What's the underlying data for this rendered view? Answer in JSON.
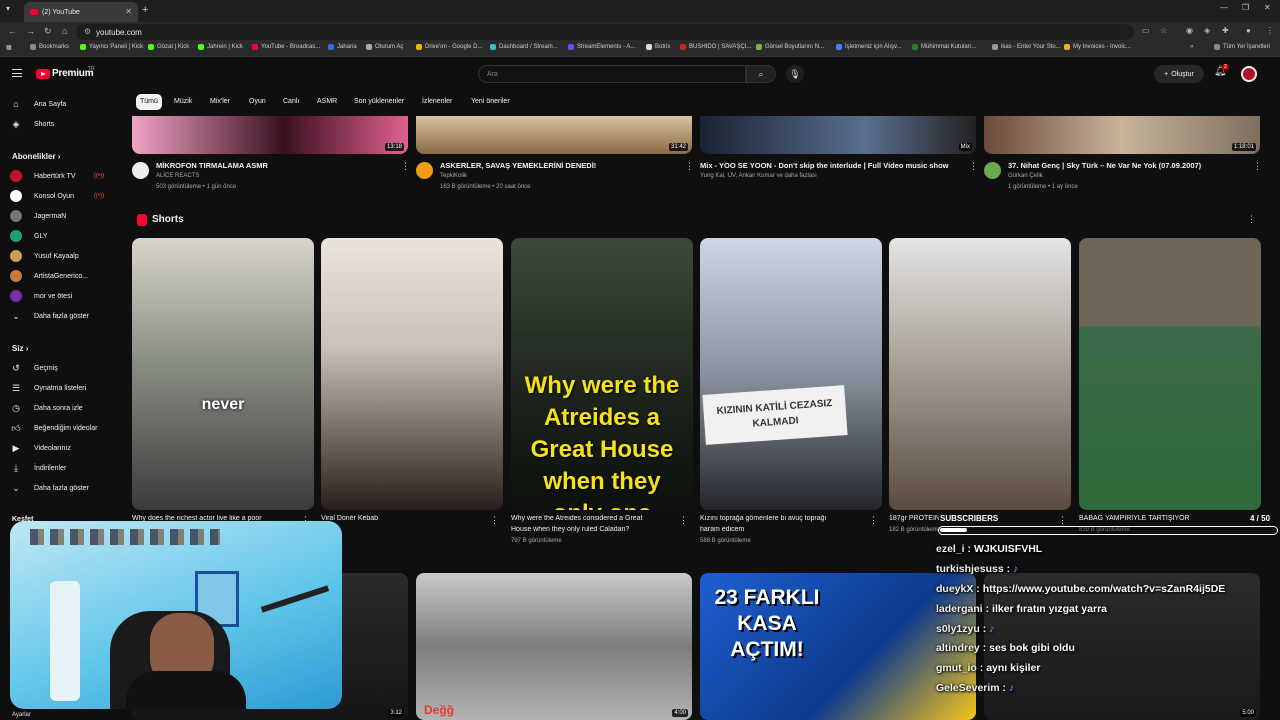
{
  "browser": {
    "tab_title": "(2) YouTube",
    "url": "youtube.com",
    "bookmarks": [
      "Bookmarks",
      "Yayıncı Paneli | Kick",
      "Gözat | Kick",
      "Jahrein | Kick",
      "YouTube - Broadcas...",
      "Jaharia",
      "Oturum Aç",
      "Drive'ım - Google D...",
      "Dashboard / Stream...",
      "StreamElements - A...",
      "Botrix",
      "BUSHIDO | SAVAŞÇI...",
      "Görsel Boyutlarını N...",
      "İşletmeniz için Alışv...",
      "Mühimmat Kutuları...",
      "ikas - Enter Your Sto...",
      "My Invoices - Invoic..."
    ],
    "all_bookmarks": "Tüm Yer İşaretleri"
  },
  "header": {
    "logo_text": "Premium",
    "logo_sup": "TR",
    "search_placeholder": "Ara",
    "create_label": "Oluştur",
    "notif_count": "2"
  },
  "sidebar": {
    "main": [
      {
        "label": "Ana Sayfa",
        "icon": "home-icon"
      },
      {
        "label": "Shorts",
        "icon": "shorts-icon"
      }
    ],
    "subs_title": "Abonelikler",
    "subs": [
      {
        "label": "Habertürk TV",
        "color": "#c4122e",
        "live": true
      },
      {
        "label": "Konsol Oyun",
        "color": "#ffffff",
        "live": true
      },
      {
        "label": "JagermaN",
        "color": "#777777",
        "live": false
      },
      {
        "label": "GLY",
        "color": "#1aa36b",
        "live": false
      },
      {
        "label": "Yusuf Kayaalp",
        "color": "#c8a05a",
        "live": false
      },
      {
        "label": "ArtistaGenerico...",
        "color": "#c97a3a",
        "live": false
      },
      {
        "label": "mor ve ötesi",
        "color": "#7a2fa5",
        "live": false
      }
    ],
    "subs_more": "Daha fazla göster",
    "you_title": "Siz",
    "you": [
      {
        "label": "Geçmiş",
        "icon": "history-icon"
      },
      {
        "label": "Oynatma listeleri",
        "icon": "playlist-icon"
      },
      {
        "label": "Daha sonra izle",
        "icon": "watch-later-icon"
      },
      {
        "label": "Beğendiğim videolar",
        "icon": "like-icon"
      },
      {
        "label": "Videolarınız",
        "icon": "your-videos-icon"
      },
      {
        "label": "İndirilenler",
        "icon": "download-icon"
      },
      {
        "label": "Daha fazla göster",
        "icon": "chevron-down-icon"
      }
    ],
    "explore": "Keşfet",
    "settings": "Ayarlar"
  },
  "chips": [
    "Tümü",
    "Müzik",
    "Mix'ler",
    "Oyun",
    "Canlı",
    "ASMR",
    "Son yüklenenler",
    "İzlenenler",
    "Yeni öneriler"
  ],
  "videos": [
    {
      "title": "MİKROFON TIRMALAMA ASMR",
      "channel": "ALİCE REACTS",
      "meta": "503 görüntüleme • 1 gün önce",
      "duration": "13:18"
    },
    {
      "title": "ASKERLER, SAVAŞ YEMEKLERİNİ DENEDİ!",
      "channel": "TepkiKolik",
      "meta": "163 B görüntüleme • 20 saat önce",
      "duration": "31:42"
    },
    {
      "title": "Mix - YOO SE YOON - Don't skip the interlude | Full Video music show",
      "channel": "Yung Kai, IJV, Ankan Kumar ve daha fazlası",
      "meta": "",
      "duration": "Mix"
    },
    {
      "title": "37. Nihat Genç | Sky Türk – Ne Var Ne Yok (07.09.2007)",
      "channel": "Gürkan Çelik",
      "meta": "1 görüntüleme • 1 ay önce",
      "duration": "1:18:01"
    }
  ],
  "shorts_title": "Shorts",
  "shorts": [
    {
      "title": "Why does the richest actor live like a poor",
      "views": "",
      "overlay": "never"
    },
    {
      "title": "Viral Donér Kebab",
      "views": "",
      "overlay": ""
    },
    {
      "title": "Why were the Atreides considered a Great",
      "title2": "House when they only ruled Caladan?",
      "views": "797 B görüntüleme",
      "overlay": "Why were the Atreides a Great House when they only one Planet?"
    },
    {
      "title": "Kızını toprağa gömenlere bi avuç toprağı",
      "title2": "haram edicem",
      "views": "588 B görüntüleme",
      "overlay": "KIZININ KATİLİ CEZASIZ KALMADI"
    },
    {
      "title": "187gr PROTEİN",
      "views": "182 B görüntüleme",
      "overlay": ""
    },
    {
      "title": "BABAG YAMPİRİYLE TARTIŞIYOR",
      "views": "839 B görüntüleme",
      "overlay": ""
    }
  ],
  "bottom": [
    {
      "duration": "3:12",
      "overlay": ""
    },
    {
      "duration": "4:00",
      "overlay": "Değğ"
    },
    {
      "duration": "",
      "overlay": "23 FARKLI KASA AÇTIM!"
    },
    {
      "duration": "5:00",
      "overlay": ""
    }
  ],
  "stream": {
    "sub_label": "SUBSCRIBERS",
    "sub_count": "4 / 50",
    "sub_progress": 0.08,
    "chat": [
      {
        "user": "ezel_i",
        "msg": "WJKUISFVHL"
      },
      {
        "user": "turkishjesuss",
        "msg": ""
      },
      {
        "user": "dueykX",
        "msg": "https://www.youtube.com/watch?v=sZanR4ij5DE"
      },
      {
        "user": "ladergani",
        "msg": "ilker fıratın yızgat yarra"
      },
      {
        "user": "s0ly1zyu",
        "msg": ""
      },
      {
        "user": "altindrey",
        "msg": "ses bok gibi oldu"
      },
      {
        "user": "gmut_io",
        "msg": "aynı kişiler"
      },
      {
        "user": "GeleSeverim",
        "msg": ""
      }
    ]
  }
}
